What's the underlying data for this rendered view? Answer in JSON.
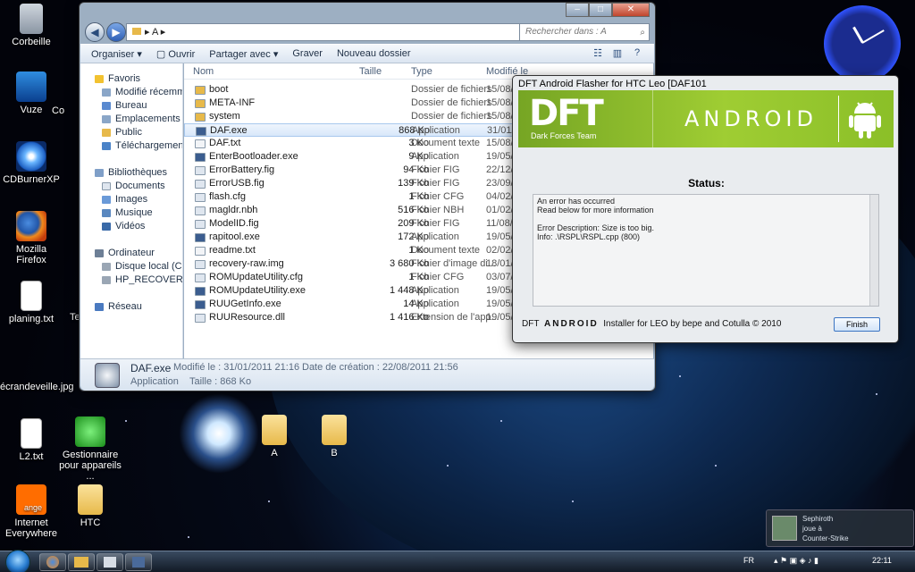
{
  "desktop": {
    "icons": [
      {
        "label": "Corbeille",
        "icon": "recycle-bin-icon"
      },
      {
        "label": "Vuze",
        "icon": "vuze-icon"
      },
      {
        "label": "Co",
        "icon": "shortcut-icon"
      },
      {
        "label": "CDBurnerXP",
        "icon": "cd-icon"
      },
      {
        "label": "Mozilla Firefox",
        "icon": "firefox-icon"
      },
      {
        "label": "planing.txt",
        "icon": "text-file-icon"
      },
      {
        "label": "Te",
        "icon": "shortcut-icon"
      },
      {
        "label": "écrandeveille.jpg",
        "icon": "image-file-icon"
      },
      {
        "label": "L2.txt",
        "icon": "text-file-icon"
      },
      {
        "label": "Gestionnaire pour appareils ...",
        "icon": "device-manager-icon"
      },
      {
        "label": "Internet Everywhere",
        "icon": "orange-icon"
      },
      {
        "label": "HTC",
        "icon": "folder-icon"
      },
      {
        "label": "A",
        "icon": "folder-icon"
      },
      {
        "label": "B",
        "icon": "folder-icon"
      }
    ],
    "orange_label": "ange"
  },
  "explorer": {
    "address": "A",
    "search_placeholder": "Rechercher dans : A",
    "toolbar": {
      "organize": "Organiser",
      "open": "Ouvrir",
      "share": "Partager avec",
      "burn": "Graver",
      "new_folder": "Nouveau dossier"
    },
    "nav": {
      "favorites": "Favoris",
      "fav_items": [
        "Modifié récemment",
        "Bureau",
        "Emplacements récen",
        "Public",
        "Téléchargements"
      ],
      "libraries": "Bibliothèques",
      "lib_items": [
        "Documents",
        "Images",
        "Musique",
        "Vidéos"
      ],
      "computer": "Ordinateur",
      "comp_items": [
        "Disque local (C:)",
        "HP_RECOVERY (D:)"
      ],
      "network": "Réseau"
    },
    "columns": {
      "name": "Nom",
      "size": "Taille",
      "type": "Type",
      "date": "Modifié le"
    },
    "files": [
      {
        "name": "boot",
        "size": "",
        "type": "Dossier de fichiers",
        "date": "15/08/",
        "kind": "folder"
      },
      {
        "name": "META-INF",
        "size": "",
        "type": "Dossier de fichiers",
        "date": "15/08/",
        "kind": "folder"
      },
      {
        "name": "system",
        "size": "",
        "type": "Dossier de fichiers",
        "date": "15/08/",
        "kind": "folder"
      },
      {
        "name": "DAF.exe",
        "size": "868 Ko",
        "type": "Application",
        "date": "31/01/",
        "kind": "exe"
      },
      {
        "name": "DAF.txt",
        "size": "3 Ko",
        "type": "Document texte",
        "date": "15/08/",
        "kind": "txt"
      },
      {
        "name": "EnterBootloader.exe",
        "size": "9 Ko",
        "type": "Application",
        "date": "19/05/",
        "kind": "exe"
      },
      {
        "name": "ErrorBattery.fig",
        "size": "94 Ko",
        "type": "Fichier FIG",
        "date": "22/12/",
        "kind": "file"
      },
      {
        "name": "ErrorUSB.fig",
        "size": "139 Ko",
        "type": "Fichier FIG",
        "date": "23/09/",
        "kind": "file"
      },
      {
        "name": "flash.cfg",
        "size": "1 Ko",
        "type": "Fichier CFG",
        "date": "04/02/",
        "kind": "file"
      },
      {
        "name": "magldr.nbh",
        "size": "516 Ko",
        "type": "Fichier NBH",
        "date": "01/02/",
        "kind": "file"
      },
      {
        "name": "ModelID.fig",
        "size": "209 Ko",
        "type": "Fichier FIG",
        "date": "11/08/",
        "kind": "file"
      },
      {
        "name": "rapitool.exe",
        "size": "172 Ko",
        "type": "Application",
        "date": "19/05/",
        "kind": "exe"
      },
      {
        "name": "readme.txt",
        "size": "1 Ko",
        "type": "Document texte",
        "date": "02/02/",
        "kind": "txt"
      },
      {
        "name": "recovery-raw.img",
        "size": "3 680 Ko",
        "type": "Fichier d'image di...",
        "date": "18/01/",
        "kind": "file"
      },
      {
        "name": "ROMUpdateUtility.cfg",
        "size": "1 Ko",
        "type": "Fichier CFG",
        "date": "03/07/",
        "kind": "file"
      },
      {
        "name": "ROMUpdateUtility.exe",
        "size": "1 448 Ko",
        "type": "Application",
        "date": "19/05/",
        "kind": "exe"
      },
      {
        "name": "RUUGetInfo.exe",
        "size": "14 Ko",
        "type": "Application",
        "date": "19/05/",
        "kind": "exe"
      },
      {
        "name": "RUUResource.dll",
        "size": "1 416 Ko",
        "type": "Extension de l'app...",
        "date": "19/05/",
        "kind": "file"
      }
    ],
    "details": {
      "name": "DAF.exe",
      "kind": "Application",
      "modified": "Modifié le : 31/01/2011 21:16",
      "size": "Taille : 868 Ko",
      "created": "Date de création : 22/08/2011 21:56"
    }
  },
  "dft": {
    "title": "DFT Android Flasher for HTC Leo [DAF101",
    "logo": "DFT",
    "logo_sub": "Dark Forces Team",
    "android": "ANDROID",
    "status_label": "Status:",
    "log": [
      "An error has occurred",
      "Read below for more information",
      "",
      "Error Description: Size is too big.",
      "Info: .\\RSPL\\RSPL.cpp (800)"
    ],
    "footer_dft": "DFT",
    "footer_android": "ANDROID",
    "footer_text": "Installer for LEO by bepe and Cotulla © 2010",
    "finish": "Finish"
  },
  "notification": {
    "user": "Sephiroth",
    "action": "joue à",
    "game": "Counter-Strike"
  },
  "taskbar": {
    "lang": "FR",
    "time": "22:11"
  },
  "colors": {
    "android_green": "#9fcd33",
    "selection": "#d8e8fa"
  }
}
